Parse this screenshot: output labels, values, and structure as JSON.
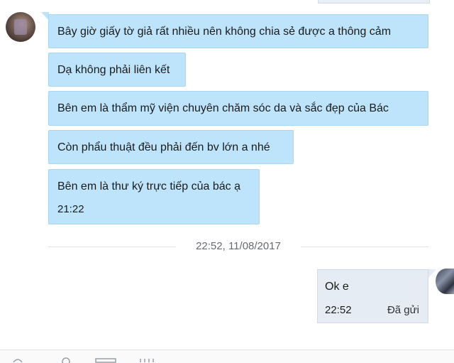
{
  "conversation": {
    "messages_in": [
      {
        "text": "Bây giờ giấy tờ giả rất nhiều nên không chia sẻ được a thông cảm",
        "time": ""
      },
      {
        "text": "Dạ không phải liên kết",
        "time": ""
      },
      {
        "text": "Bên em là thẩm mỹ viện chuyên chăm sóc da và sắc đẹp của Bác",
        "time": ""
      },
      {
        "text": "Còn phẩu thuật đều phải đến bv lớn a nhé",
        "time": ""
      },
      {
        "text": "Bên em là thư ký trực tiếp của bác ạ",
        "time": "21:22"
      }
    ],
    "separator_label": "22:52, 11/08/2017",
    "message_out": {
      "text": "Ok e",
      "time": "22:52",
      "status": "Đã gửi"
    }
  },
  "icons": {
    "left_avatar": "contact-avatar",
    "right_avatar": "user-avatar",
    "toolbar": [
      "sticker-icon",
      "emoji-icon",
      "image-icon",
      "attachment-icon"
    ]
  },
  "colors": {
    "incoming_bubble": "#bde4fb",
    "outgoing_bubble": "#e5ecf3",
    "separator_text": "#666a6e"
  }
}
